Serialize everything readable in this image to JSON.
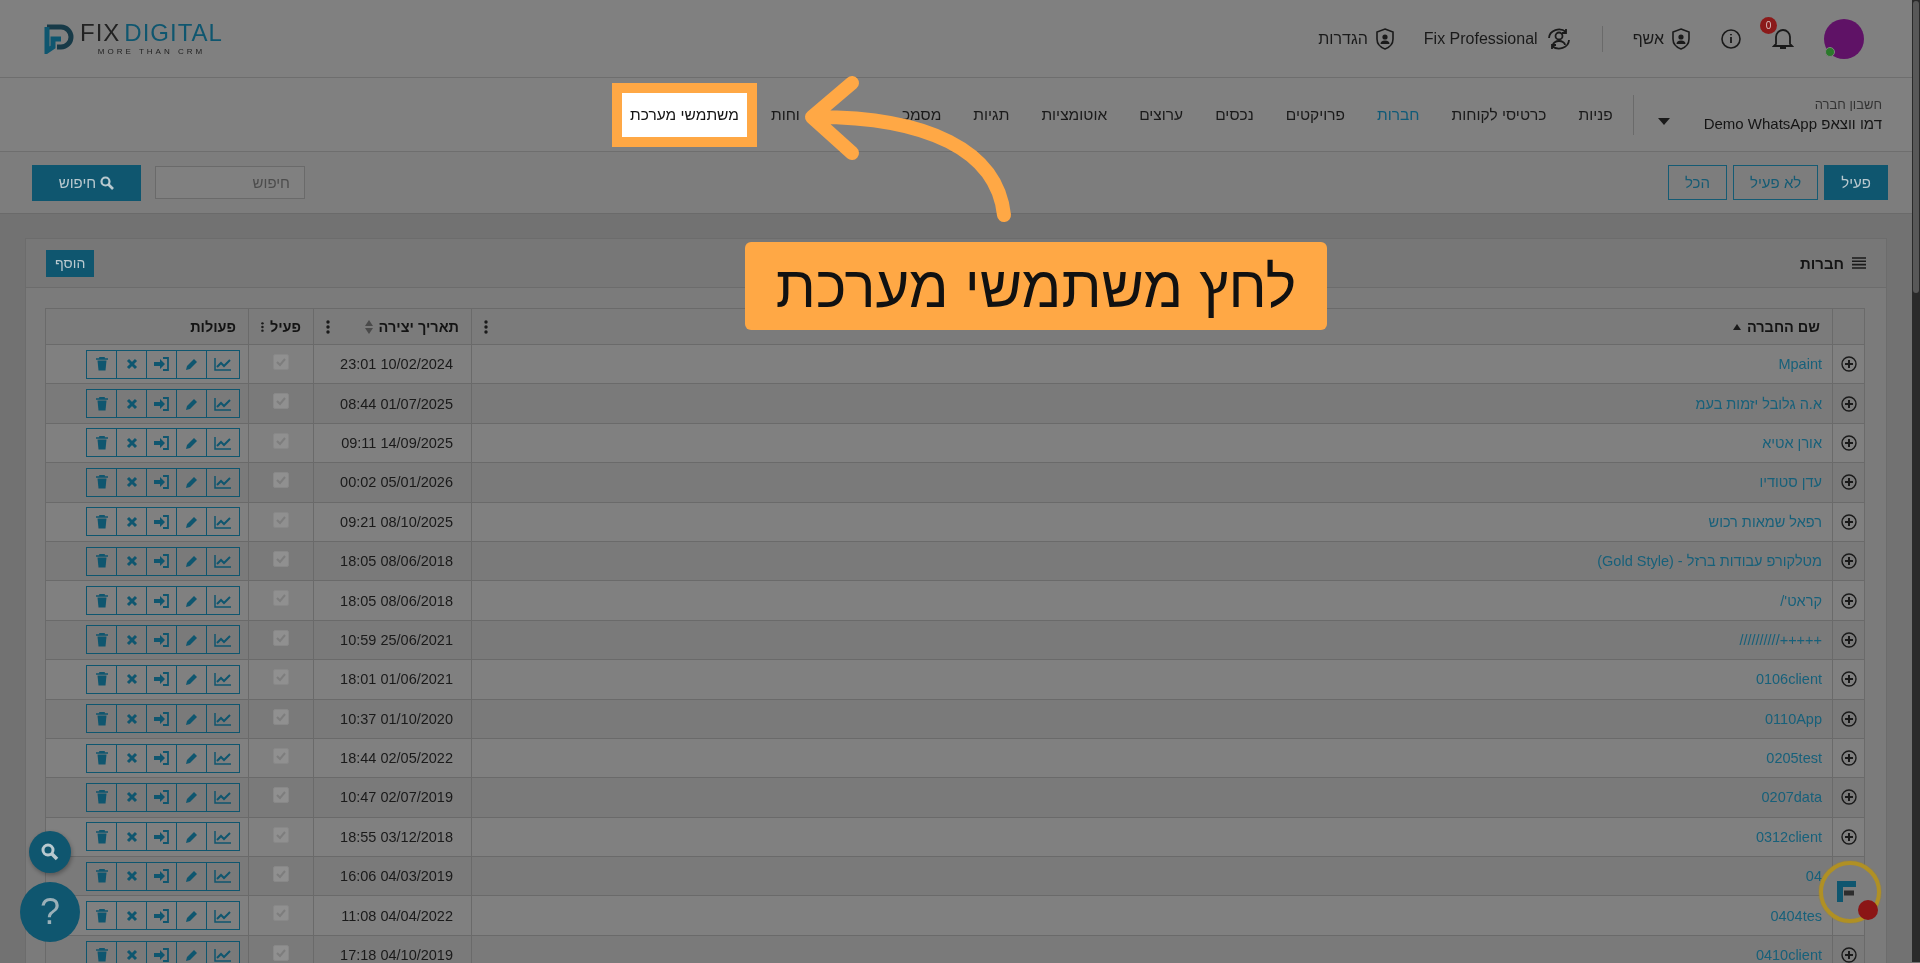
{
  "header": {
    "logo": {
      "word_1": "FIX",
      "word_2": "DIGITAL",
      "tagline": "MORE THAN CRM"
    },
    "settings_link": "הגדרות",
    "plan_link": "Fix Professional",
    "wizard_link": "אשף",
    "notifications_count": "0",
    "avatar": {
      "online": true
    }
  },
  "nav": {
    "account_label": "חשבון חברה",
    "account_name": "דמו ווצאפ Demo WhatsApp",
    "items": [
      {
        "label": "פניות",
        "selected": false,
        "spotlit": false
      },
      {
        "label": "כרטיסי לקוחות",
        "selected": false,
        "spotlit": false
      },
      {
        "label": "חברות",
        "selected": true,
        "spotlit": false
      },
      {
        "label": "פרויקטים",
        "selected": false,
        "spotlit": false
      },
      {
        "label": "נכסים",
        "selected": false,
        "spotlit": false
      },
      {
        "label": "ערוצים",
        "selected": false,
        "spotlit": false
      },
      {
        "label": "אוטומציות",
        "selected": false,
        "spotlit": false
      },
      {
        "label": "תגיות",
        "selected": false,
        "spotlit": false
      },
      {
        "label": "מסמכ",
        "selected": false,
        "spotlit": false
      },
      {
        "label": "וחות",
        "selected": false,
        "spotlit": false
      },
      {
        "label": "משתמשי מערכת",
        "selected": false,
        "spotlit": true
      }
    ]
  },
  "toolbar": {
    "filters": [
      {
        "label": "פעיל",
        "selected": true
      },
      {
        "label": "לא פעיל",
        "selected": false
      },
      {
        "label": "הכל",
        "selected": false
      }
    ],
    "search": {
      "placeholder": "חיפוש",
      "button": "חיפוש"
    }
  },
  "panel": {
    "title": "חברות",
    "add_button": "הוסף",
    "table": {
      "columns": [
        {
          "label": "שם החברה",
          "sortable": true,
          "sorted": true,
          "menu": true
        },
        {
          "label": "תאריך יצירה",
          "sortable": true,
          "sorted": false,
          "menu": true
        },
        {
          "label": "פעיל",
          "sortable": false,
          "menu": true
        },
        {
          "label": "פעולות",
          "sortable": false,
          "menu": false
        }
      ],
      "rows": [
        {
          "name": "Mpaint",
          "created": "23:01 10/02/2024",
          "active": true
        },
        {
          "name": "א.ה גלובל יזמות בעמ",
          "created": "08:44 01/07/2025",
          "active": true
        },
        {
          "name": "אורן אטיא",
          "created": "09:11 14/09/2025",
          "active": true
        },
        {
          "name": "עדן סטודיו",
          "created": "00:02 05/01/2026",
          "active": true
        },
        {
          "name": "רפאל שמאות רכוש",
          "created": "09:21 08/10/2025",
          "active": true
        },
        {
          "name": "מטלקורפ עבודות ברזל - (Gold Style)",
          "created": "18:05 08/06/2018",
          "active": true
        },
        {
          "name": "קראט'/",
          "created": "18:05 08/06/2018",
          "active": true
        },
        {
          "name": "+++++//////////",
          "created": "10:59 25/06/2021",
          "active": true
        },
        {
          "name": "0106client",
          "created": "18:01 01/06/2021",
          "active": true
        },
        {
          "name": "0110App",
          "created": "10:37 01/10/2020",
          "active": true
        },
        {
          "name": "0205test",
          "created": "18:44 02/05/2022",
          "active": true
        },
        {
          "name": "0207data",
          "created": "10:47 02/07/2019",
          "active": true
        },
        {
          "name": "0312client",
          "created": "18:55 03/12/2018",
          "active": true
        },
        {
          "name": "04",
          "created": "16:06 04/03/2019",
          "active": true
        },
        {
          "name": "0404tes",
          "created": "11:08 04/04/2022",
          "active": true
        },
        {
          "name": "0410client",
          "created": "17:18 04/10/2019",
          "active": true
        }
      ]
    }
  },
  "help_button": "?",
  "tutorial": {
    "callout": "לחץ משתמשי מערכת"
  }
}
